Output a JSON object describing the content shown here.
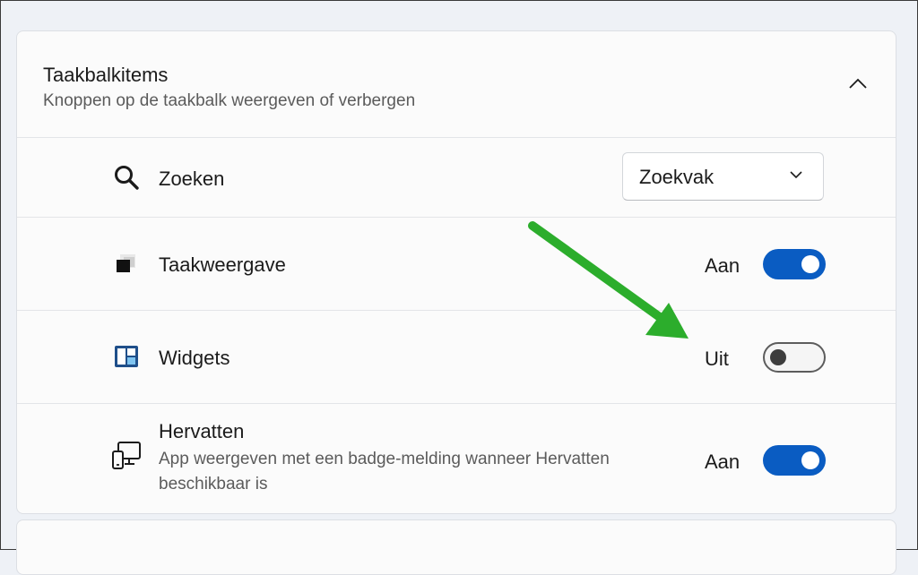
{
  "section": {
    "title": "Taakbalkitems",
    "subtitle": "Knoppen op de taakbalk weergeven of verbergen",
    "expanded": true
  },
  "items": [
    {
      "icon": "search-icon",
      "label": "Zoeken",
      "control": "dropdown",
      "value": "Zoekvak"
    },
    {
      "icon": "task-view-icon",
      "label": "Taakweergave",
      "control": "toggle",
      "state_label": "Aan",
      "on": true
    },
    {
      "icon": "widgets-icon",
      "label": "Widgets",
      "control": "toggle",
      "state_label": "Uit",
      "on": false
    },
    {
      "icon": "resume-devices-icon",
      "label": "Hervatten",
      "description": "App weergeven met een badge-melding wanneer Hervatten beschikbaar is",
      "control": "toggle",
      "state_label": "Aan",
      "on": true
    }
  ],
  "colors": {
    "accent": "#0a5cc2",
    "annotation_arrow": "#2cad2c",
    "background": "#eef1f6",
    "card": "#fbfbfb"
  }
}
